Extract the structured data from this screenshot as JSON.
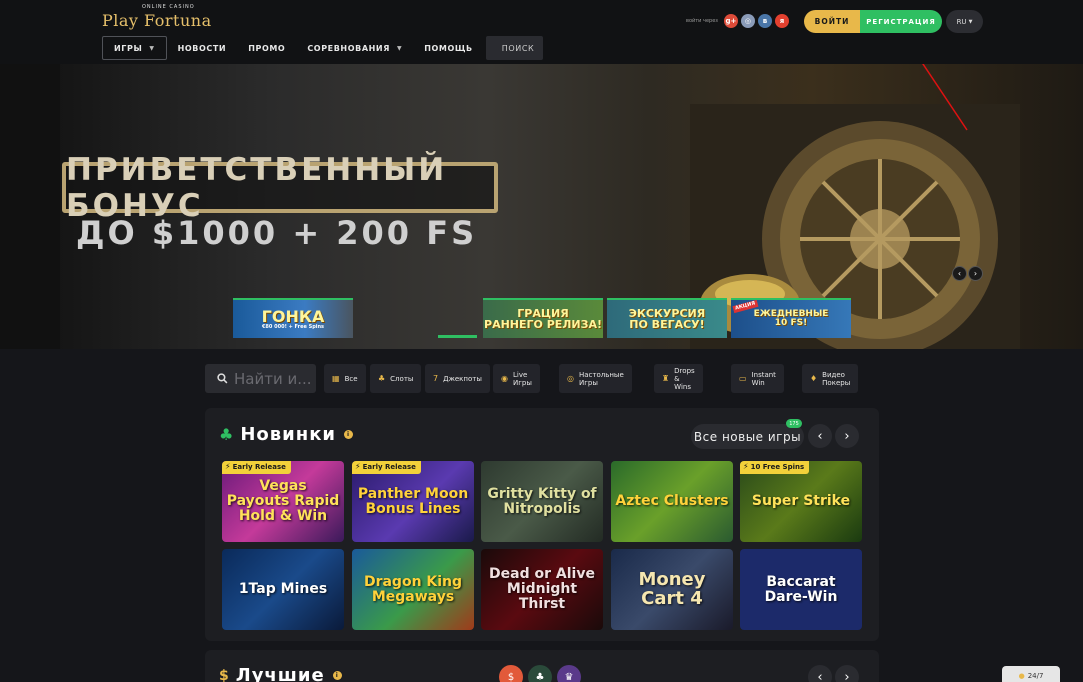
{
  "header": {
    "logo_small": "ONLINE CASINO",
    "logo_main": "Play Fortuna",
    "nav": [
      {
        "label": "ИГРЫ",
        "has_caret": true
      },
      {
        "label": "НОВОСТИ"
      },
      {
        "label": "ПРОМО"
      },
      {
        "label": "СОРЕВНОВАНИЯ",
        "has_caret": true
      },
      {
        "label": "ПОМОЩЬ"
      }
    ],
    "search_label": "ПОИСК",
    "social_label": "войти через",
    "social": [
      "g+",
      "◎",
      "в",
      "я"
    ],
    "login_label": "ВОЙТИ",
    "register_label": "РЕГИСТРАЦИЯ",
    "lang": "RU"
  },
  "banner": {
    "title": "ПРИВЕТСТВЕННЫЙ БОНУС",
    "subtitle": "ДО $1000 + 200 FS",
    "thumbs": [
      {
        "t1": "ГОНКА",
        "t2": "€80 000! + Free Spins"
      },
      {
        "t1": "",
        "t2": ""
      },
      {
        "t1": "ГРАЦИЯ",
        "t2": "РАННЕГО РЕЛИЗА!"
      },
      {
        "t1": "ЭКСКУРСИЯ",
        "t2": "ПО ВЕГАСУ!"
      },
      {
        "t1": "ЕЖЕДНЕВНЫЕ",
        "t2": "10 FS!",
        "tag": "АКЦИЯ"
      }
    ],
    "active_slide_progress": 0.33
  },
  "filters": {
    "search_placeholder": "Найти и...",
    "chips": [
      "Все",
      "Слоты",
      "Джекпоты",
      "Live Игры",
      "Настольные Игры",
      "Drops & Wins",
      "Instant Win",
      "Видео Покеры"
    ]
  },
  "new_games": {
    "title": "Новинки",
    "all_label": "Все новые игры",
    "count": "175",
    "games": [
      {
        "name": "Vegas Payouts Rapid Hold & Win",
        "tag": "Early Release"
      },
      {
        "name": "Panther Moon Bonus Lines",
        "tag": "Early Release"
      },
      {
        "name": "Gritty Kitty of Nitropolis",
        "tag": ""
      },
      {
        "name": "Aztec Clusters",
        "tag": ""
      },
      {
        "name": "Super Strike",
        "tag": "10 Free Spins"
      },
      {
        "name": "1Tap Mines",
        "tag": ""
      },
      {
        "name": "Dragon King Megaways",
        "tag": ""
      },
      {
        "name": "Dead or Alive Midnight Thirst",
        "tag": ""
      },
      {
        "name": "Money Cart 4",
        "tag": ""
      },
      {
        "name": "Baccarat Dare-Win",
        "tag": ""
      }
    ]
  },
  "best_games": {
    "title": "Лучшие"
  },
  "support": {
    "label": "24/7"
  },
  "colors": {
    "accent_gold": "#e8b84a",
    "accent_green": "#2fbf62",
    "background": "#15161a"
  }
}
